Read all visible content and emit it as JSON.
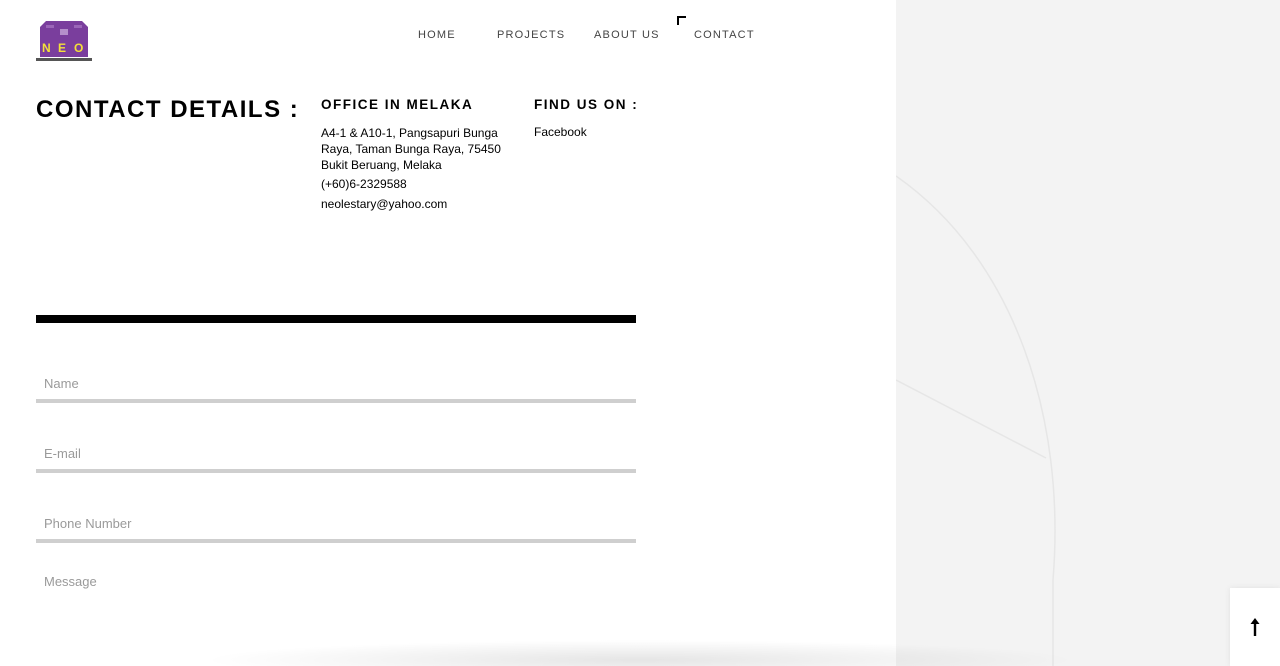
{
  "brand": {
    "logo_text": "NEO",
    "logo_purple": "#7a3e9d",
    "logo_yellow": "#f3e03a"
  },
  "nav": {
    "items": [
      {
        "label": "HOME"
      },
      {
        "label": "PROJECTS"
      },
      {
        "label": "ABOUT US"
      },
      {
        "label": "CONTACT"
      }
    ],
    "active": "CONTACT"
  },
  "contact": {
    "title": "CONTACT DETAILS :",
    "office": {
      "heading": "OFFICE IN MELAKA",
      "address": "A4-1 & A10-1, Pangsapuri Bunga Raya, Taman Bunga Raya, 75450 Bukit Beruang, Melaka",
      "phone": "(+60)6-2329588",
      "email": "neolestary@yahoo.com"
    },
    "social": {
      "heading": "FIND US ON :",
      "facebook": "Facebook"
    }
  },
  "form": {
    "name_placeholder": "Name",
    "email_placeholder": "E-mail",
    "phone_placeholder": "Phone Number",
    "message_placeholder": "Message"
  },
  "scroll_top": {
    "icon": "arrow-up-icon"
  }
}
